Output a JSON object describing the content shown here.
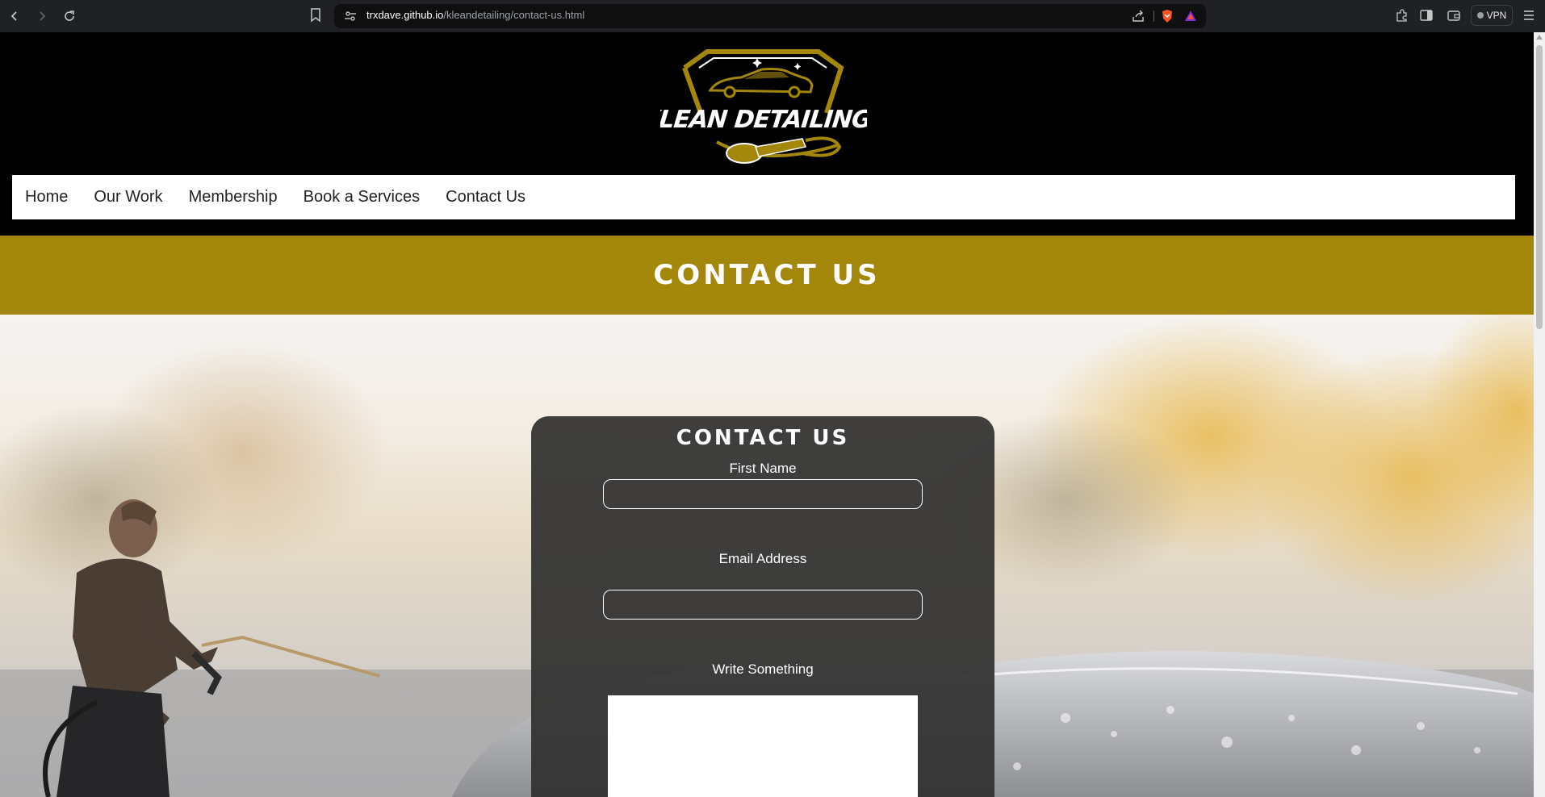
{
  "browser": {
    "url_host": "trxdave.github.io",
    "url_path": "/kleandetailing/contact-us.html",
    "vpn_label": "VPN",
    "icons": [
      "back-icon",
      "forward-icon",
      "reload-icon",
      "bookmark-icon",
      "site-settings-icon",
      "share-icon",
      "brave-shields-icon",
      "brave-rewards-icon",
      "extensions-icon",
      "sidebar-icon",
      "wallet-icon",
      "menu-icon"
    ]
  },
  "logo": {
    "text": "KLEAN DETAILING",
    "accent": "#a3870a"
  },
  "nav": {
    "items": [
      {
        "label": "Home"
      },
      {
        "label": "Our Work"
      },
      {
        "label": "Membership"
      },
      {
        "label": "Book a Services"
      },
      {
        "label": "Contact Us"
      }
    ]
  },
  "banner": {
    "title": "CONTACT US",
    "color": "#a3870a"
  },
  "form": {
    "title": "CONTACT US",
    "first_name_label": "First Name",
    "first_name_value": "",
    "email_label": "Email Address",
    "email_value": "",
    "message_label": "Write Something",
    "message_value": ""
  }
}
